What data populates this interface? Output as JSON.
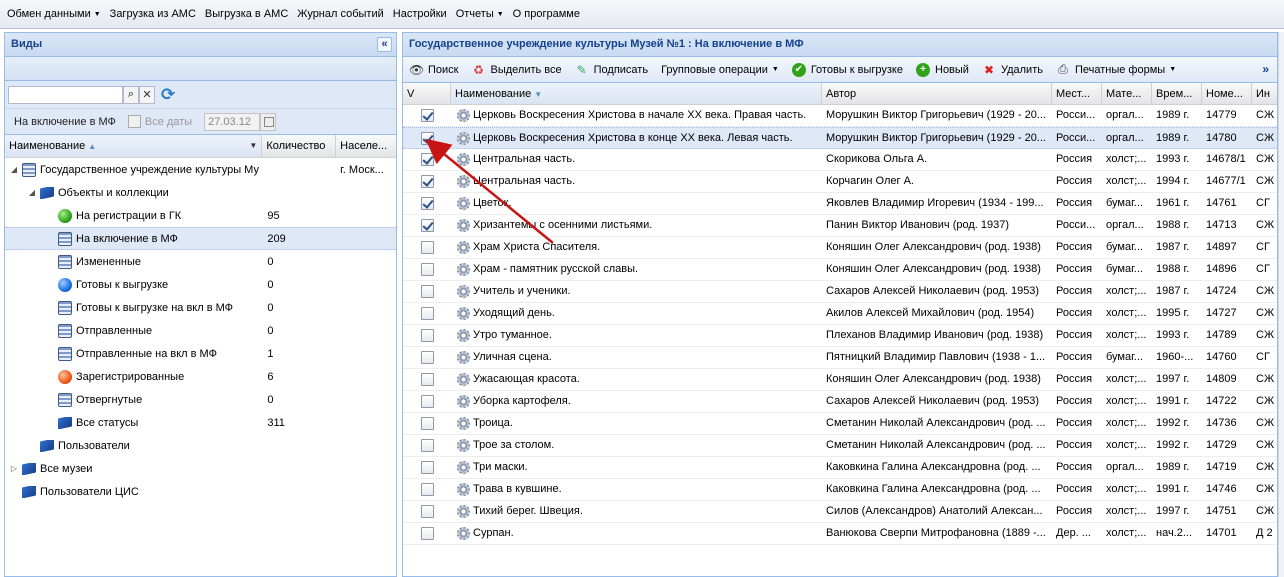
{
  "menubar": {
    "items": [
      {
        "label": "Обмен данными",
        "dropdown": true
      },
      {
        "label": "Загрузка из АМС",
        "dropdown": false
      },
      {
        "label": "Выгрузка в АМС",
        "dropdown": false
      },
      {
        "label": "Журнал событий",
        "dropdown": false
      },
      {
        "label": "Настройки",
        "dropdown": false
      },
      {
        "label": "Отчеты",
        "dropdown": true
      },
      {
        "label": "О программе",
        "dropdown": false
      }
    ]
  },
  "left": {
    "title": "Виды",
    "filter_label": "На включение в МФ",
    "all_dates_label": "Все даты",
    "date_value": "27.03.12",
    "columns": {
      "name": "Наименование",
      "count": "Количество",
      "place": "Населе..."
    },
    "tree": [
      {
        "label": "Государственное учреждение культуры Му",
        "count": "",
        "place": "г. Моск...",
        "icon": "database-icon",
        "level": 0,
        "toggle": "expanded"
      },
      {
        "label": "Объекты и коллекции",
        "count": "",
        "place": "",
        "icon": "book-icon",
        "level": 1,
        "toggle": "expanded"
      },
      {
        "label": "На регистрации в ГК",
        "count": "95",
        "place": "",
        "icon": "green-status-icon",
        "level": 2,
        "toggle": ""
      },
      {
        "label": "На включение в МФ",
        "count": "209",
        "place": "",
        "icon": "database-icon",
        "level": 2,
        "toggle": "",
        "selected": true
      },
      {
        "label": "Измененные",
        "count": "0",
        "place": "",
        "icon": "database-icon",
        "level": 2,
        "toggle": ""
      },
      {
        "label": "Готовы к выгрузке",
        "count": "0",
        "place": "",
        "icon": "blue-status-icon",
        "level": 2,
        "toggle": ""
      },
      {
        "label": "Готовы к выгрузке на вкл в МФ",
        "count": "0",
        "place": "",
        "icon": "database-icon",
        "level": 2,
        "toggle": ""
      },
      {
        "label": "Отправленные",
        "count": "0",
        "place": "",
        "icon": "database-icon",
        "level": 2,
        "toggle": ""
      },
      {
        "label": "Отправленные на вкл в МФ",
        "count": "1",
        "place": "",
        "icon": "database-icon",
        "level": 2,
        "toggle": ""
      },
      {
        "label": "Зарегистрированные",
        "count": "6",
        "place": "",
        "icon": "red-status-icon",
        "level": 2,
        "toggle": ""
      },
      {
        "label": "Отвергнутые",
        "count": "0",
        "place": "",
        "icon": "database-icon",
        "level": 2,
        "toggle": ""
      },
      {
        "label": "Все статусы",
        "count": "311",
        "place": "",
        "icon": "book-icon",
        "level": 2,
        "toggle": ""
      },
      {
        "label": "Пользователи",
        "count": "",
        "place": "",
        "icon": "book-icon",
        "level": 1,
        "toggle": ""
      },
      {
        "label": "Все музеи",
        "count": "",
        "place": "",
        "icon": "book-icon",
        "level": 0,
        "toggle": "collapsed"
      },
      {
        "label": "Пользователи ЦИС",
        "count": "",
        "place": "",
        "icon": "book-icon",
        "level": 0,
        "toggle": ""
      }
    ]
  },
  "right": {
    "title": "Государственное учреждение культуры Музей №1 : На включение в МФ",
    "toolbar": [
      {
        "label": "Поиск",
        "icon": "binoculars-icon",
        "dropdown": false
      },
      {
        "label": "Выделить все",
        "icon": "select-all-icon",
        "dropdown": false
      },
      {
        "label": "Подписать",
        "icon": "sign-document-icon",
        "dropdown": false
      },
      {
        "label": "Групповые операции",
        "icon": "",
        "dropdown": true
      },
      {
        "label": "Готовы к выгрузке",
        "icon": "green-check-icon",
        "dropdown": false
      },
      {
        "label": "Новый",
        "icon": "green-plus-icon",
        "dropdown": false
      },
      {
        "label": "Удалить",
        "icon": "red-x-icon",
        "dropdown": false
      },
      {
        "label": "Печатные формы",
        "icon": "printer-icon",
        "dropdown": true
      }
    ],
    "more_label": "»",
    "columns": {
      "v": "V",
      "name": "Наименование",
      "author": "Автор",
      "place": "Мест...",
      "material": "Мате...",
      "time": "Врем...",
      "number": "Номе...",
      "extra": "Ин"
    },
    "rows": [
      {
        "checked": true,
        "name": "Церковь Воскресения Христова в начале XX века. Правая часть.",
        "author": "Морушкин Виктор Григорьевич (1929 - 20...",
        "place": "Росси...",
        "material": "оргал...",
        "time": "1989 г.",
        "number": "14779",
        "extra": "СЖ"
      },
      {
        "checked": true,
        "name": "Церковь Воскресения Христова в конце XX века. Левая часть.",
        "author": "Морушкин Виктор Григорьевич (1929 - 20...",
        "place": "Росси...",
        "material": "оргал...",
        "time": "1989 г.",
        "number": "14780",
        "extra": "СЖ",
        "selected": true
      },
      {
        "checked": true,
        "name": "Центральная часть.",
        "author": "Скорикова Ольга А.",
        "place": "Россия",
        "material": "холст;...",
        "time": "1993 г.",
        "number": "14678/1",
        "extra": "СЖ"
      },
      {
        "checked": true,
        "name": "Центральная часть.",
        "author": "Корчагин Олег А.",
        "place": "Россия",
        "material": "холст;...",
        "time": "1994 г.",
        "number": "14677/1",
        "extra": "СЖ"
      },
      {
        "checked": true,
        "name": "Цветок.",
        "author": "Яковлев Владимир Игоревич (1934 - 199...",
        "place": "Россия",
        "material": "бумаг...",
        "time": "1961 г.",
        "number": "14761",
        "extra": "СГ"
      },
      {
        "checked": true,
        "name": "Хризантемы с осенними листьями.",
        "author": "Панин Виктор Иванович (род. 1937)",
        "place": "Росси...",
        "material": "оргал...",
        "time": "1988 г.",
        "number": "14713",
        "extra": "СЖ"
      },
      {
        "checked": false,
        "name": "Храм Христа Спасителя.",
        "author": "Коняшин Олег Александрович (род. 1938)",
        "place": "Россия",
        "material": "бумаг...",
        "time": "1987 г.",
        "number": "14897",
        "extra": "СГ"
      },
      {
        "checked": false,
        "name": "Храм - памятник русской славы.",
        "author": "Коняшин Олег Александрович (род. 1938)",
        "place": "Россия",
        "material": "бумаг...",
        "time": "1988 г.",
        "number": "14896",
        "extra": "СГ"
      },
      {
        "checked": false,
        "name": "Учитель и ученики.",
        "author": "Сахаров Алексей Николаевич (род. 1953)",
        "place": "Россия",
        "material": "холст;...",
        "time": "1987 г.",
        "number": "14724",
        "extra": "СЖ"
      },
      {
        "checked": false,
        "name": "Уходящий день.",
        "author": "Акилов Алексей Михайлович (род. 1954)",
        "place": "Россия",
        "material": "холст;...",
        "time": "1995 г.",
        "number": "14727",
        "extra": "СЖ"
      },
      {
        "checked": false,
        "name": "Утро туманное.",
        "author": "Плеханов Владимир Иванович (род. 1938)",
        "place": "Россия",
        "material": "холст;...",
        "time": "1993 г.",
        "number": "14789",
        "extra": "СЖ"
      },
      {
        "checked": false,
        "name": "Уличная сцена.",
        "author": "Пятницкий Владимир Павлович (1938 - 1...",
        "place": "Россия",
        "material": "бумаг...",
        "time": "1960-...",
        "number": "14760",
        "extra": "СГ"
      },
      {
        "checked": false,
        "name": "Ужасающая красота.",
        "author": "Коняшин Олег Александрович (род. 1938)",
        "place": "Россия",
        "material": "холст;...",
        "time": "1997 г.",
        "number": "14809",
        "extra": "СЖ"
      },
      {
        "checked": false,
        "name": "Уборка картофеля.",
        "author": "Сахаров Алексей Николаевич (род. 1953)",
        "place": "Россия",
        "material": "холст;...",
        "time": "1991 г.",
        "number": "14722",
        "extra": "СЖ"
      },
      {
        "checked": false,
        "name": "Троица.",
        "author": "Сметанин Николай Александрович (род. ...",
        "place": "Россия",
        "material": "холст;...",
        "time": "1992 г.",
        "number": "14736",
        "extra": "СЖ"
      },
      {
        "checked": false,
        "name": "Трое за столом.",
        "author": "Сметанин Николай Александрович (род. ...",
        "place": "Россия",
        "material": "холст;...",
        "time": "1992 г.",
        "number": "14729",
        "extra": "СЖ"
      },
      {
        "checked": false,
        "name": "Три маски.",
        "author": "Каковкина Галина Александровна (род. ...",
        "place": "Россия",
        "material": "оргал...",
        "time": "1989 г.",
        "number": "14719",
        "extra": "СЖ"
      },
      {
        "checked": false,
        "name": "Трава в кувшине.",
        "author": "Каковкина Галина Александровна (род. ...",
        "place": "Россия",
        "material": "холст;...",
        "time": "1991 г.",
        "number": "14746",
        "extra": "СЖ"
      },
      {
        "checked": false,
        "name": "Тихий берег. Швеция.",
        "author": "Силов (Александров) Анатолий Алексан...",
        "place": "Россия",
        "material": "холст;...",
        "time": "1997 г.",
        "number": "14751",
        "extra": "СЖ"
      },
      {
        "checked": false,
        "name": "Сурпан.",
        "author": "Ванюкова Сверпи Митрофановна (1889 -...",
        "place": "Дер. ...",
        "material": "холст;...",
        "time": "нач.2...",
        "number": "14701",
        "extra": "Д 2"
      }
    ]
  },
  "colors": {
    "header_text": "#15428b",
    "panel_border": "#99bbe8",
    "selection": "#dfe8f6",
    "annotation_arrow": "#c81414"
  }
}
